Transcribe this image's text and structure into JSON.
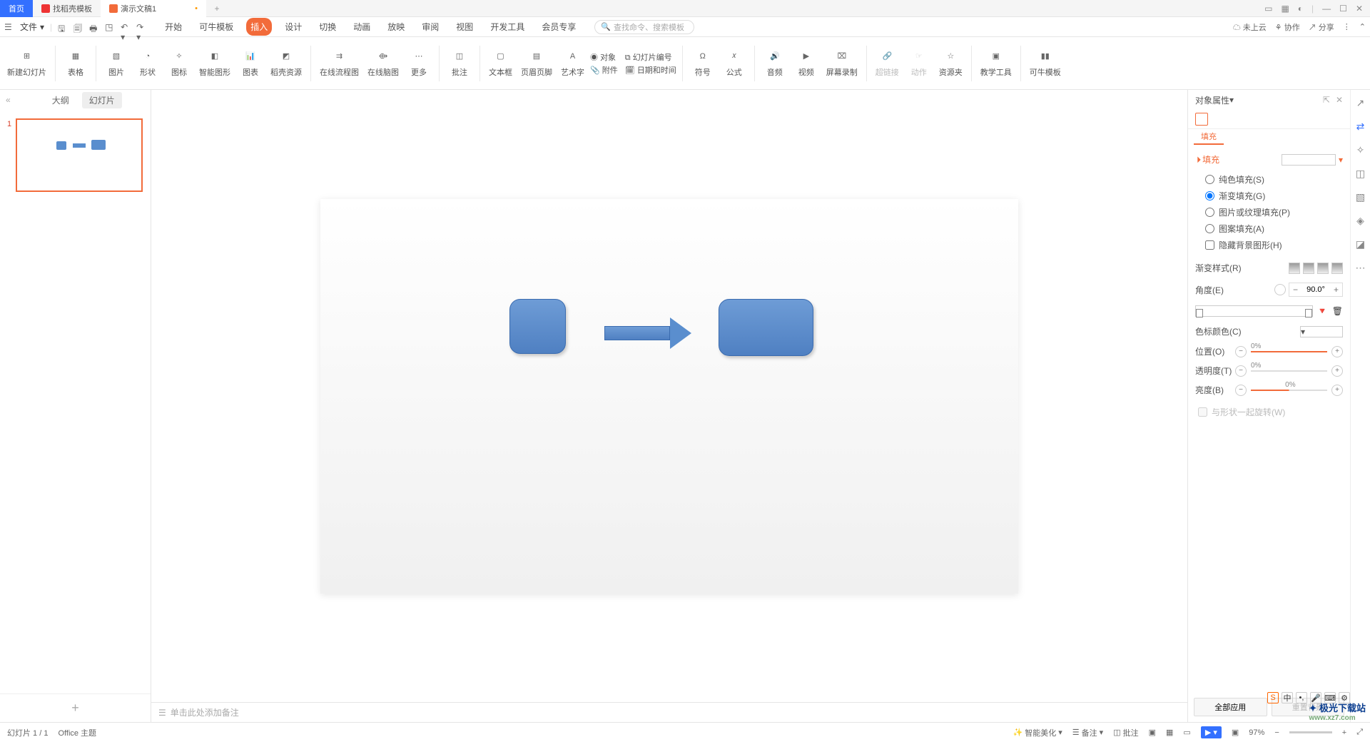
{
  "tabs": {
    "home": "首页",
    "template": "找稻壳模板",
    "doc": "演示文稿1"
  },
  "file_menu": "文件",
  "menu": {
    "start": "开始",
    "konu": "可牛模板",
    "insert": "插入",
    "design": "设计",
    "transition": "切换",
    "animation": "动画",
    "show": "放映",
    "review": "审阅",
    "view": "视图",
    "dev": "开发工具",
    "member": "会员专享"
  },
  "search_placeholder": "查找命令、搜索模板",
  "cloud": "未上云",
  "collab": "协作",
  "share": "分享",
  "ribbon": {
    "new_slide": "新建幻灯片",
    "table": "表格",
    "image": "图片",
    "shape": "形状",
    "icon": "图标",
    "smartart": "智能图形",
    "chart": "图表",
    "res": "稻壳资源",
    "online_flow": "在线流程图",
    "online_mind": "在线脑图",
    "more": "更多",
    "comment": "批注",
    "textbox": "文本框",
    "header": "页眉页脚",
    "wordart": "艺术字",
    "object": "对象",
    "attach": "附件",
    "slide_num": "幻灯片编号",
    "datetime": "日期和时间",
    "symbol": "符号",
    "formula": "公式",
    "audio": "音频",
    "video": "视频",
    "record": "屏幕录制",
    "hyperlink": "超链接",
    "action": "动作",
    "resfolder": "资源夹",
    "teaching": "教学工具",
    "konu2": "可牛模板"
  },
  "left_panel": {
    "outline": "大纲",
    "slides": "幻灯片"
  },
  "notes_placeholder": "单击此处添加备注",
  "right_panel": {
    "title": "对象属性",
    "tab": "填充",
    "section": "填充",
    "solid": "纯色填充(S)",
    "gradient": "渐变填充(G)",
    "picture": "图片或纹理填充(P)",
    "pattern": "图案填充(A)",
    "hide": "隐藏背景图形(H)",
    "grad_style": "渐变样式(R)",
    "angle": "角度(E)",
    "angle_val": "90.0°",
    "stop_color": "色标颜色(C)",
    "position": "位置(O)",
    "pos_val": "0%",
    "transparency": "透明度(T)",
    "trans_val": "0%",
    "brightness": "亮度(B)",
    "bright_val": "0%",
    "rotate": "与形状一起旋转(W)",
    "apply_all": "全部应用",
    "reset": "重置背景"
  },
  "status": {
    "slide": "幻灯片 1 / 1",
    "theme": "Office 主题",
    "beautify": "智能美化",
    "notes": "备注",
    "comments": "批注",
    "zoom": "97%"
  },
  "watermark": "极光下载站",
  "wm_url": "www.xz7.com"
}
